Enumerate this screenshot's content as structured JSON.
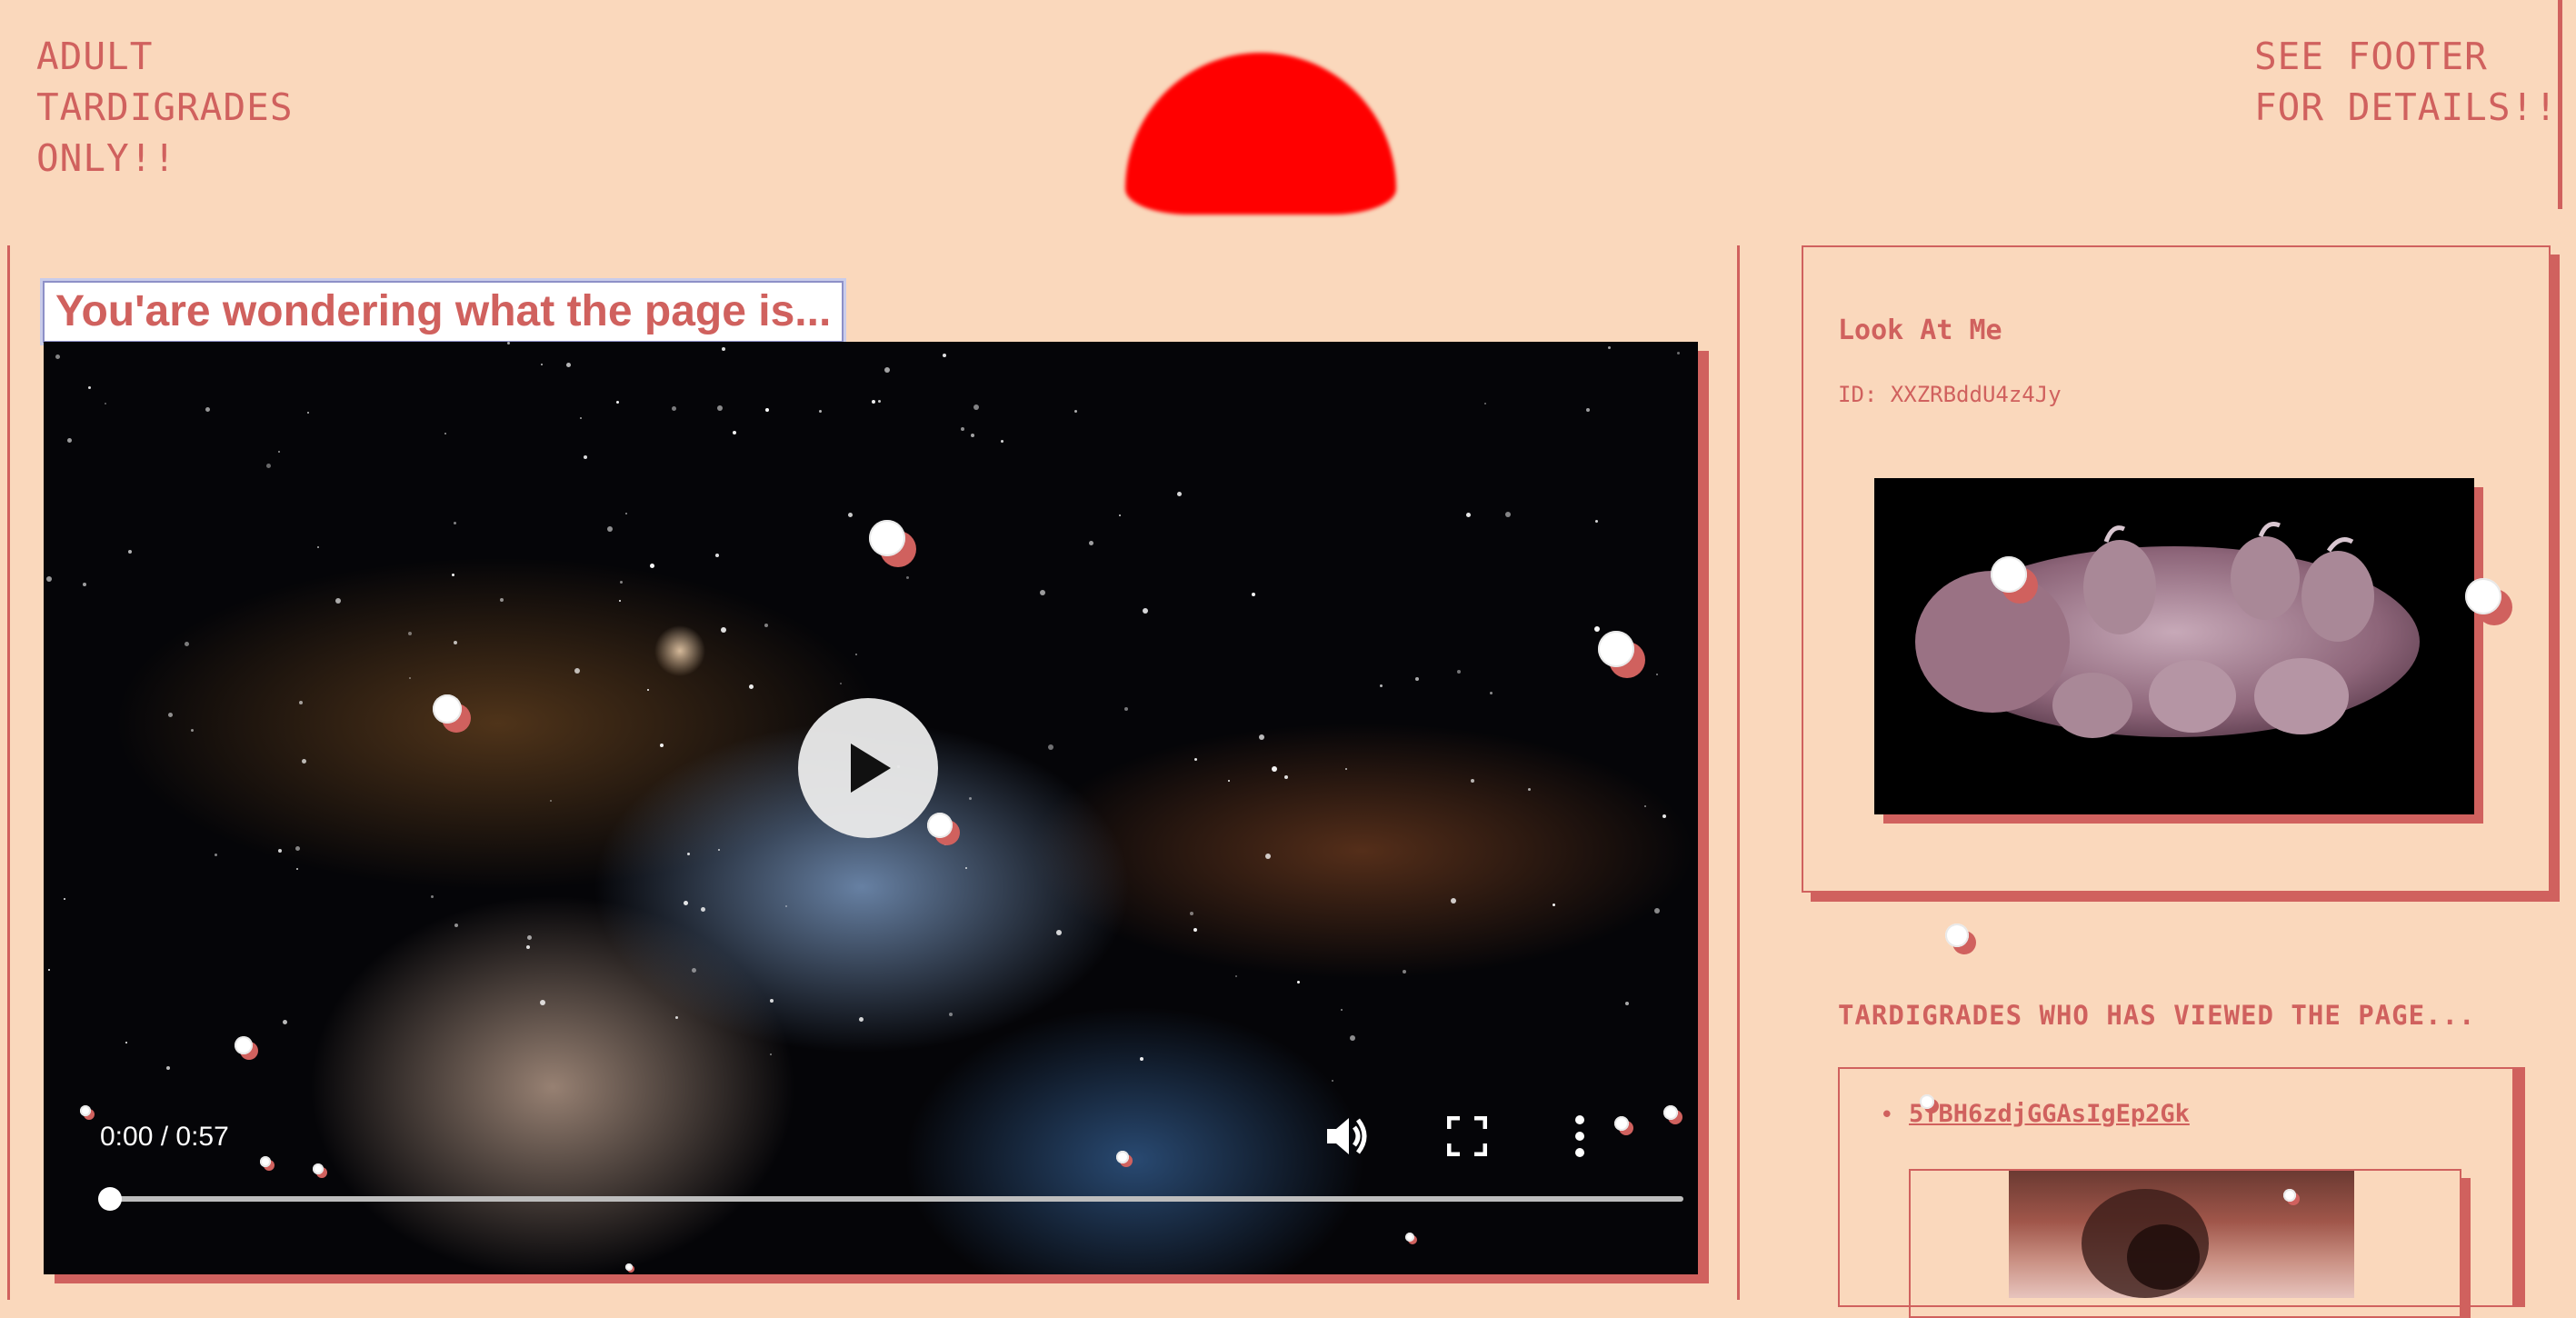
{
  "header": {
    "left_text": "ADULT\nTARDIGRADES\nONLY!!",
    "right_text": "SEE FOOTER\nFOR DETAILS!!"
  },
  "main": {
    "heading": "You'are wondering what the page is...",
    "video": {
      "current_time": "0:00",
      "separator": " / ",
      "duration": "0:57",
      "progress": 0,
      "icons": [
        "play-icon",
        "volume-icon",
        "fullscreen-icon",
        "more-options-icon"
      ]
    }
  },
  "aside": {
    "card": {
      "title": "Look At Me",
      "id_text": "ID: XXZRBddU4z4Jy"
    },
    "viewers": {
      "heading": "TARDIGRADES WHO HAS VIEWED THE PAGE...",
      "items": [
        {
          "name": "5fBH6zdjGGAsIgEp2Gk"
        }
      ]
    }
  },
  "colors": {
    "background": "#fad8bc",
    "accent": "#d0615e",
    "sun": "#ff0000"
  }
}
